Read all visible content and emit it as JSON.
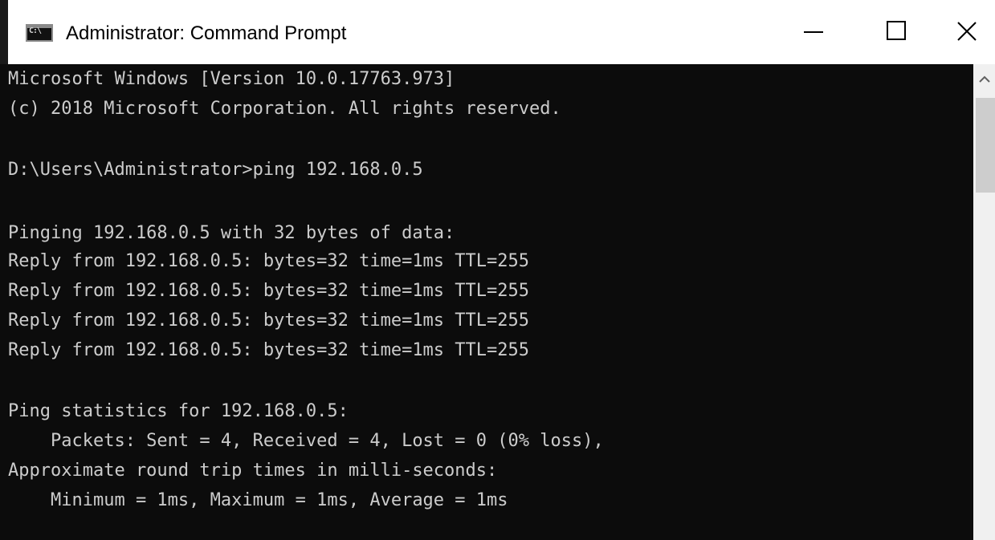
{
  "window": {
    "title": "Administrator: Command Prompt",
    "icon_text": "C:\\",
    "app_icon": "command-prompt-icon"
  },
  "controls": {
    "minimize_icon": "minimize-icon",
    "maximize_icon": "maximize-icon",
    "close_icon": "close-icon"
  },
  "console": {
    "lines": [
      "Microsoft Windows [Version 10.0.17763.973]",
      "(c) 2018 Microsoft Corporation. All rights reserved.",
      "",
      "D:\\Users\\Administrator>ping 192.168.0.5",
      "",
      "Pinging 192.168.0.5 with 32 bytes of data:",
      "Reply from 192.168.0.5: bytes=32 time=1ms TTL=255",
      "Reply from 192.168.0.5: bytes=32 time=1ms TTL=255",
      "Reply from 192.168.0.5: bytes=32 time=1ms TTL=255",
      "Reply from 192.168.0.5: bytes=32 time=1ms TTL=255",
      "",
      "Ping statistics for 192.168.0.5:",
      "    Packets: Sent = 4, Received = 4, Lost = 0 (0% loss),",
      "Approximate round trip times in milli-seconds:",
      "    Minimum = 1ms, Maximum = 1ms, Average = 1ms"
    ],
    "text_color": "#cccccc",
    "background_color": "#0c0c0c"
  },
  "scrollbar": {
    "up_icon": "chevron-up-icon"
  }
}
